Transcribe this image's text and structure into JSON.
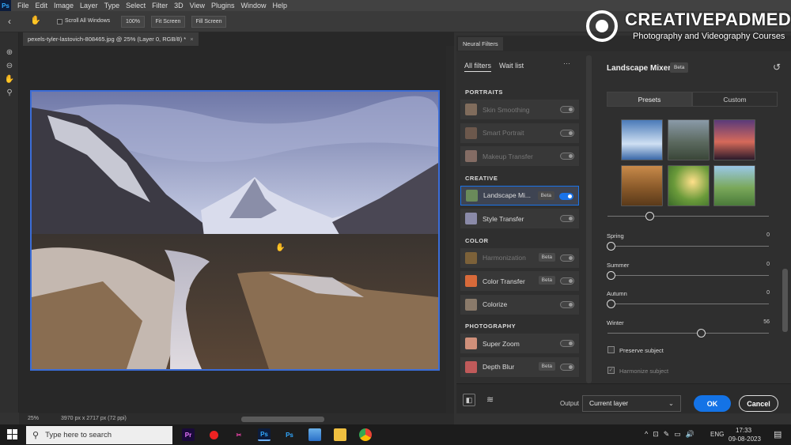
{
  "app": {
    "logo": "Ps"
  },
  "menubar": {
    "items": [
      "File",
      "Edit",
      "Image",
      "Layer",
      "Type",
      "Select",
      "Filter",
      "3D",
      "View",
      "Plugins",
      "Window",
      "Help"
    ]
  },
  "options_bar": {
    "scroll_all_label": "Scroll All Windows",
    "zoom_label": "100%",
    "fit_screen_label": "Fit Screen",
    "fill_screen_label": "Fill Screen"
  },
  "document": {
    "tab_title": "pexels-tyler-lastovich-808465.jpg @ 25% (Layer 0, RGB/8) *",
    "tab_close": "×",
    "zoom": "25%",
    "doc_info": "3970 px x 2717 px (72 ppi)"
  },
  "neural_filters": {
    "panel_title": "Neural Filters",
    "tabs": [
      "All filters",
      "Wait list"
    ],
    "more_label": "···",
    "sections": [
      {
        "title": "PORTRAITS",
        "filters": [
          {
            "name": "Skin Smoothing",
            "beta": false,
            "on": false,
            "dim": true
          },
          {
            "name": "Smart Portrait",
            "beta": false,
            "on": false,
            "dim": true
          },
          {
            "name": "Makeup Transfer",
            "beta": false,
            "on": false,
            "dim": true
          }
        ]
      },
      {
        "title": "CREATIVE",
        "filters": [
          {
            "name": "Landscape Mi...",
            "beta": true,
            "on": true,
            "dim": false
          },
          {
            "name": "Style Transfer",
            "beta": false,
            "on": false,
            "dim": false
          }
        ]
      },
      {
        "title": "COLOR",
        "filters": [
          {
            "name": "Harmonization",
            "beta": true,
            "on": false,
            "dim": true
          },
          {
            "name": "Color Transfer",
            "beta": true,
            "on": false,
            "dim": false
          },
          {
            "name": "Colorize",
            "beta": false,
            "on": false,
            "dim": false
          }
        ]
      },
      {
        "title": "PHOTOGRAPHY",
        "filters": [
          {
            "name": "Super Zoom",
            "beta": false,
            "on": false,
            "dim": false
          },
          {
            "name": "Depth Blur",
            "beta": true,
            "on": false,
            "dim": false
          }
        ]
      }
    ],
    "beta_label": "Beta"
  },
  "settings": {
    "title": "Landscape Mixer",
    "beta_label": "Beta",
    "segments": [
      "Presets",
      "Custom"
    ],
    "sliders": [
      {
        "label": "Spring",
        "value": "0",
        "fraction": 0
      },
      {
        "label": "Summer",
        "value": "0",
        "fraction": 0
      },
      {
        "label": "Autumn",
        "value": "0",
        "fraction": 0
      },
      {
        "label": "Winter",
        "value": "56",
        "fraction": 0.56
      }
    ],
    "top_slider_fraction": 0.26,
    "checkboxes": [
      {
        "label": "Preserve subject",
        "checked": false
      },
      {
        "label": "Harmonize subject",
        "checked": true
      }
    ]
  },
  "footer": {
    "output_label": "Output",
    "output_value": "Current layer",
    "ok_label": "OK",
    "cancel_label": "Cancel"
  },
  "taskbar": {
    "search_placeholder": "Type here to search",
    "lang": "ENG",
    "time": "17:33",
    "date": "09-08-2023"
  },
  "watermark": {
    "brand": "CREATIVEPADMEDIA",
    "tagline": "Photography and Videography Courses"
  },
  "colors": {
    "accent": "#1473e6",
    "selection_border": "#3b6dd8"
  }
}
